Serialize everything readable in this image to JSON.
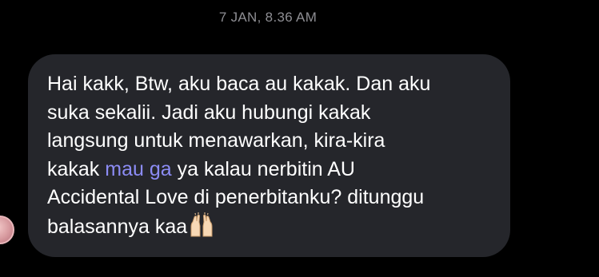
{
  "conversation": {
    "timestamp": "7 JAN, 8.36 AM"
  },
  "message": {
    "line1": "Hai kakk, Btw, aku baca au kakak. Dan aku",
    "line2": "suka sekalii. Jadi aku hubungi kakak",
    "line3": "langsung untuk menawarkan, kira-kira",
    "line4_before": "kakak ",
    "line4_link": "mau ga",
    "line4_after": " ya kalau nerbitin AU",
    "line5": "Accidental Love di penerbitanku? ditunggu",
    "line6": "balasannya kaa",
    "emoji_icon": "raising-hands-emoji",
    "colors": {
      "bubble": "#25262b",
      "text": "#ffffff",
      "link": "#8c8cf5",
      "timestamp": "#8e8e93",
      "background": "#000000"
    }
  }
}
